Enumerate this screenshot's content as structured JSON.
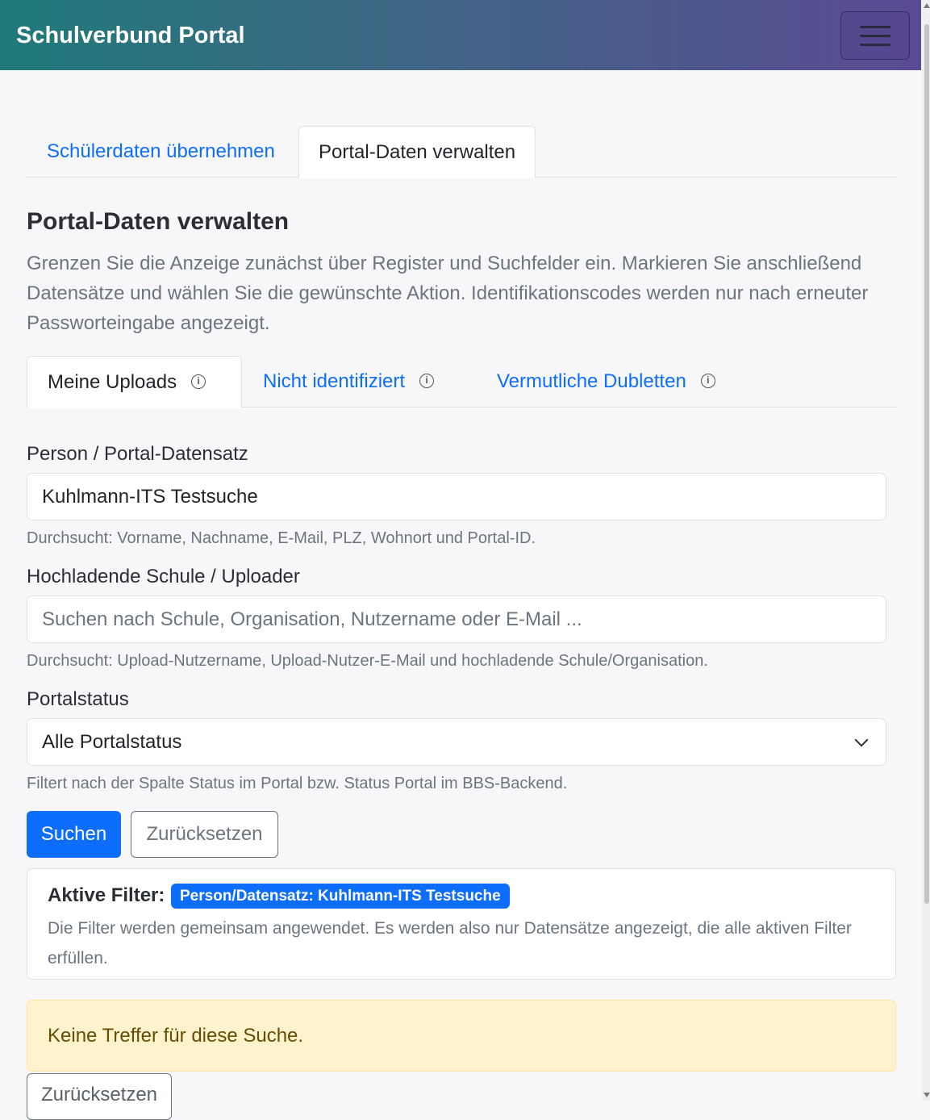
{
  "navbar": {
    "brand": "Schulverbund Portal",
    "menu_icon": "hamburger-menu-icon"
  },
  "main_tabs": [
    {
      "label": "Schülerdaten übernehmen",
      "active": false
    },
    {
      "label": "Portal-Daten verwalten",
      "active": true
    }
  ],
  "section": {
    "title": "Portal-Daten verwalten",
    "description": "Grenzen Sie die Anzeige zunächst über Register und Suchfelder ein. Markieren Sie anschließend Datensätze und wählen Sie die gewünschte Aktion. Identifikationscodes werden nur nach erneuter Passworteingabe angezeigt."
  },
  "sub_tabs": [
    {
      "label": "Meine Uploads",
      "active": true,
      "icon": "info-icon"
    },
    {
      "label": "Nicht identifiziert",
      "active": false,
      "icon": "info-icon"
    },
    {
      "label": "Vermutliche Dubletten",
      "active": false,
      "icon": "info-icon"
    }
  ],
  "form": {
    "person": {
      "label": "Person / Portal-Datensatz",
      "value": "Kuhlmann-ITS Testsuche",
      "hint": "Durchsucht: Vorname, Nachname, E-Mail, PLZ, Wohnort und Portal-ID."
    },
    "uploader": {
      "label": "Hochladende Schule / Uploader",
      "value": "",
      "placeholder": "Suchen nach Schule, Organisation, Nutzername oder E-Mail ...",
      "hint": "Durchsucht: Upload-Nutzername, Upload-Nutzer-E-Mail und hochladende Schule/Organisation."
    },
    "status": {
      "label": "Portalstatus",
      "selected": "Alle Portalstatus",
      "hint": "Filtert nach der Spalte Status im Portal bzw. Status Portal im BBS-Backend."
    },
    "search_button": "Suchen",
    "reset_button": "Zurücksetzen"
  },
  "active_filters": {
    "title": "Aktive Filter:",
    "badge": "Person/Datensatz: Kuhlmann-ITS Testsuche",
    "text": "Die Filter werden gemeinsam angewendet. Es werden also nur Datensätze angezeigt, die alle aktiven Filter erfüllen."
  },
  "alert": {
    "text": "Keine Treffer für diese Suche."
  },
  "bottom_reset_button": "Zurücksetzen",
  "colors": {
    "primary": "#0d6efd",
    "warning_bg": "#fff3cd",
    "warning_text": "#664d03"
  }
}
